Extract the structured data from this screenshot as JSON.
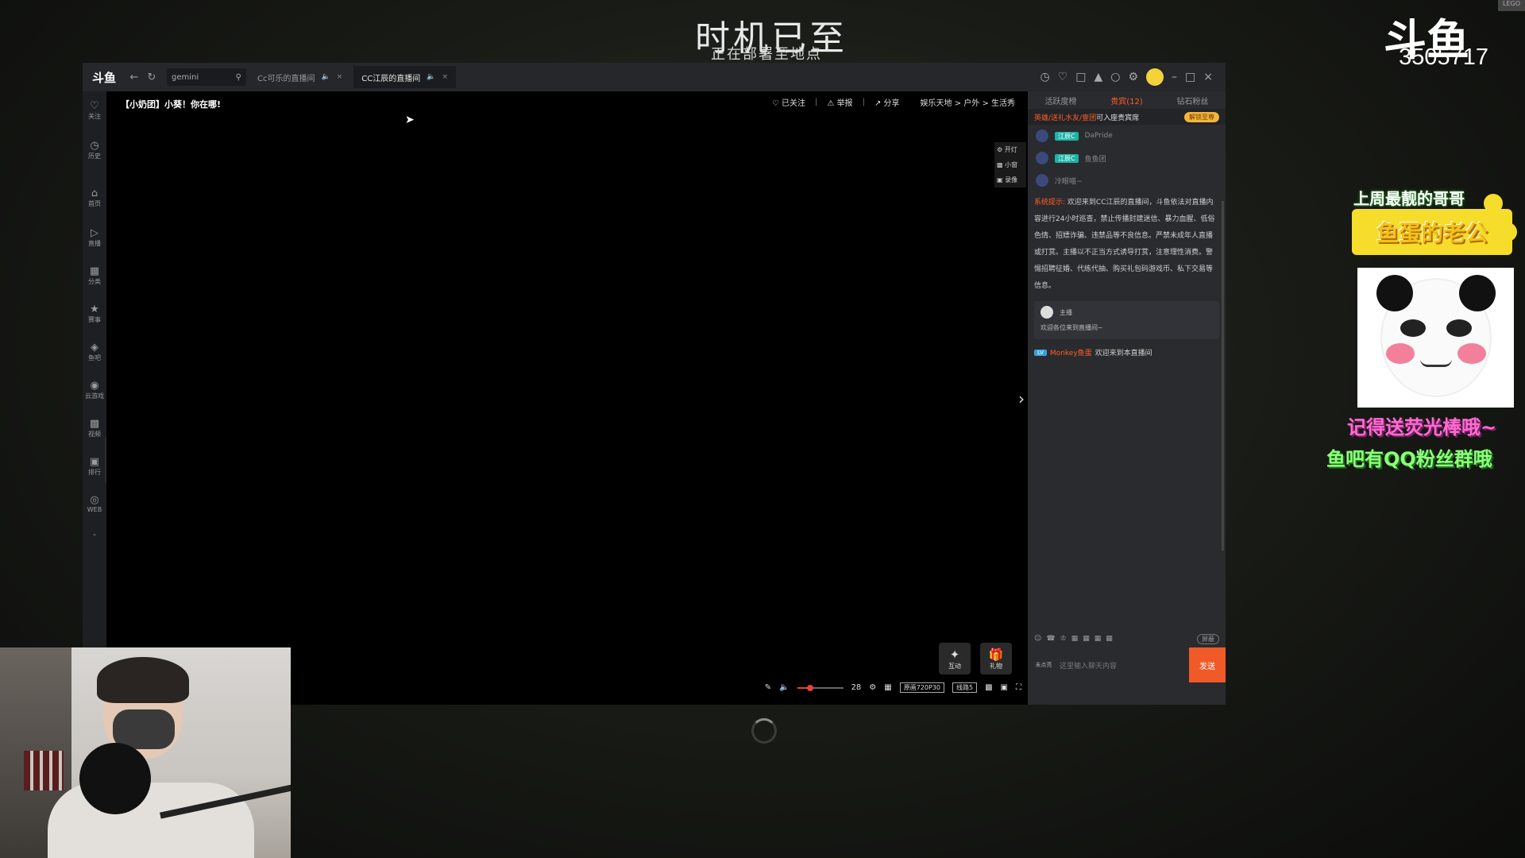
{
  "overlay": {
    "banner_title": "时机已至",
    "banner_subtitle": "正在部署至地点",
    "platform_logo": "斗鱼",
    "room_number": "3505717",
    "corner_badge": "LEGO",
    "promo_line1": "上周最靓的哥哥",
    "promo_line2": "鱼蛋的老公",
    "promo_line3": "记得送荧光棒哦~",
    "promo_line4": "鱼吧有QQ粉丝群哦"
  },
  "titlebar": {
    "app_logo": "斗鱼",
    "back_icon": "arrow-left-icon",
    "refresh_icon": "refresh-icon",
    "search_value": "gemini",
    "tabs": [
      {
        "label": "Cc可乐的直播间",
        "active": false
      },
      {
        "label": "CC江辰的直播间",
        "active": true
      }
    ]
  },
  "sidebar": {
    "items": [
      {
        "label": "关注",
        "icon": "heart-icon"
      },
      {
        "label": "历史",
        "icon": "clock-icon"
      },
      {
        "label": "首页",
        "icon": "home-icon"
      },
      {
        "label": "直播",
        "icon": "tv-icon"
      },
      {
        "label": "分类",
        "icon": "grid-icon"
      },
      {
        "label": "赛事",
        "icon": "trophy-icon"
      },
      {
        "label": "鱼吧",
        "icon": "fish-icon"
      },
      {
        "label": "云游戏",
        "icon": "gamepad-icon"
      },
      {
        "label": "视频",
        "icon": "video-icon"
      },
      {
        "label": "排行",
        "icon": "rank-icon"
      },
      {
        "label": "WEB",
        "icon": "web-icon"
      }
    ]
  },
  "video": {
    "room_title": "【小奶团】小葵！你在哪!",
    "follow_label": "已关注",
    "report_label": "举报",
    "share_label": "分享",
    "breadcrumb": [
      "娱乐天地",
      "户外",
      "生活秀"
    ],
    "tools": [
      "开灯",
      "小窗",
      "录像"
    ],
    "interact_label": "互动",
    "gift_label": "礼物",
    "volume_value": "28",
    "volume_level": 0.28,
    "quality_label": "原画720P30",
    "line_label": "线路5"
  },
  "chat": {
    "tabs": [
      "活跃度榜",
      "贵宾(12)",
      "钻石粉丝"
    ],
    "vip_tip_red": "英雄/送礼水友/壹团",
    "vip_tip_text": "可入座贵宾席",
    "unlock_label": "解锁至尊",
    "viewers": [
      {
        "level": "江辰C",
        "name": "DaPride"
      },
      {
        "level": "江辰C",
        "name": "鱼鱼团"
      },
      {
        "level": "",
        "name": "冷眼喵~"
      }
    ],
    "sys_prefix": "系统提示:",
    "sys_text": "欢迎来到CC江辰的直播间，斗鱼依法对直播内容进行24小时巡查，禁止传播封建迷信、暴力血腥、低俗色情、招嫖诈骗、违禁品等不良信息。严禁未成年人直播或打赏。主播以不正当方式诱导打赏，注意理性消费。警惕招聘征婚、代练代抽、购买礼包码游戏币、私下交易等信息。",
    "anchor_role": "主播",
    "anchor_msg": "欢迎各位来到直播间~",
    "welcome_badge": "LV",
    "welcome_name": "Monkey鱼蛋",
    "welcome_text": "欢迎来到本直播间",
    "hide_label": "屏蔽",
    "input_lock": "未点亮",
    "input_placeholder": "这里输入聊天内容",
    "send_label": "发送"
  }
}
